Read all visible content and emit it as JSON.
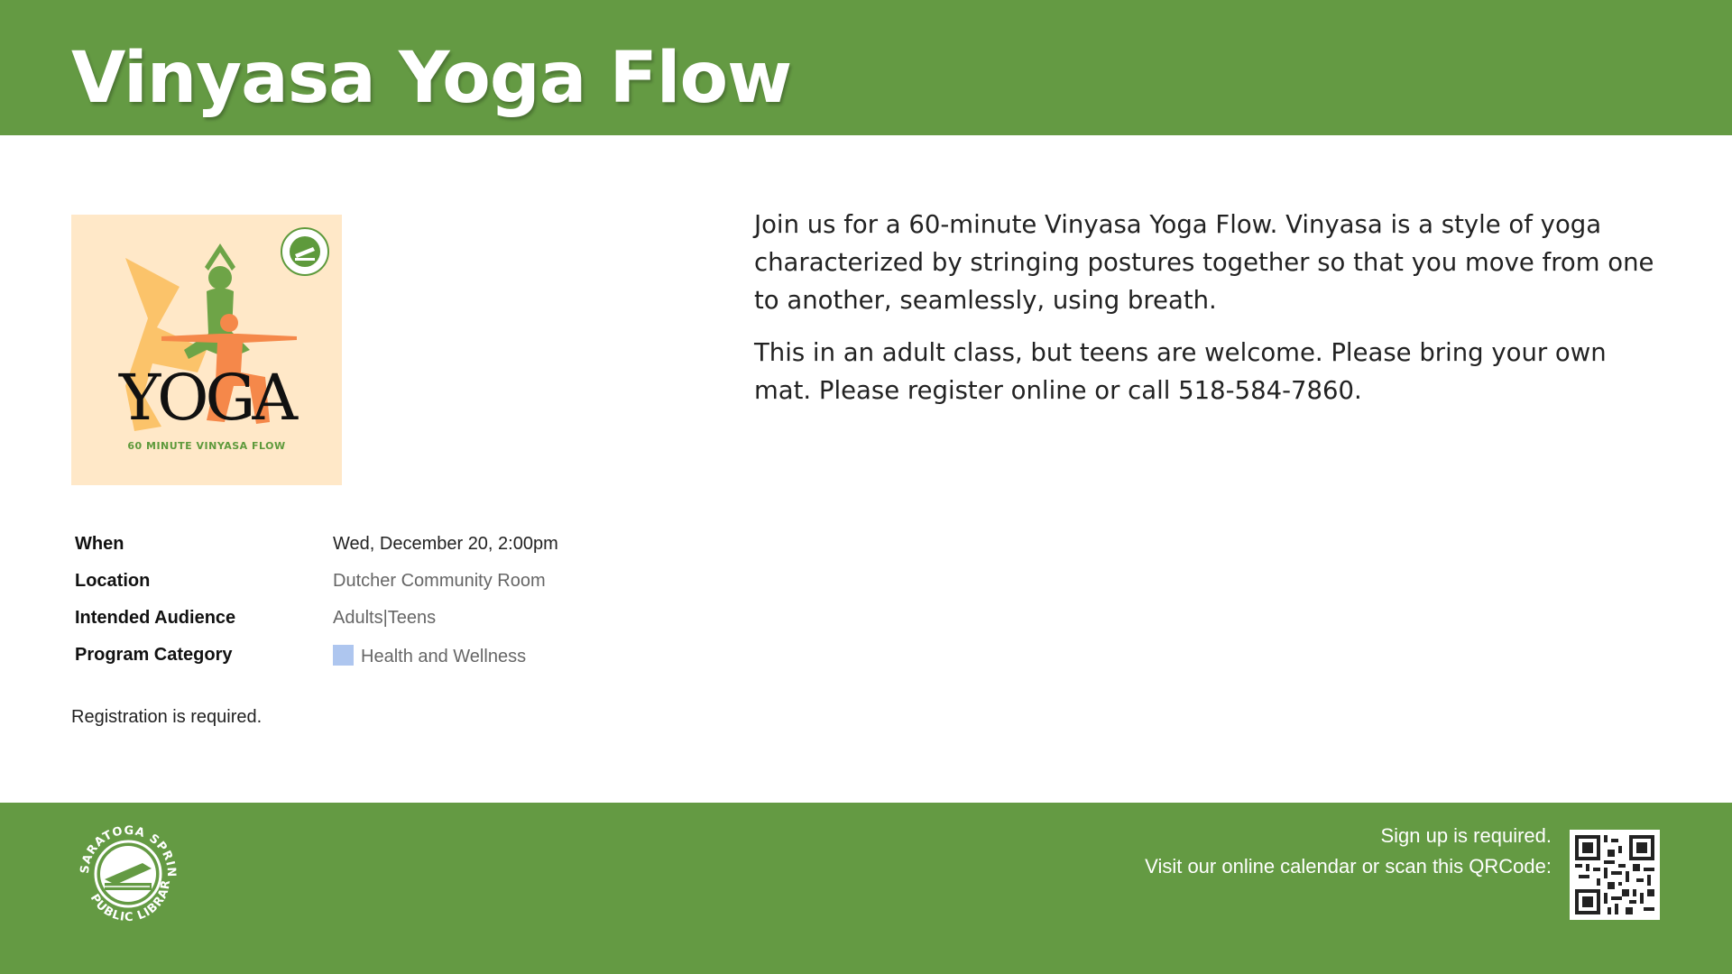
{
  "header": {
    "title": "Vinyasa Yoga Flow"
  },
  "poster": {
    "word": "YOGA",
    "subtitle": "60 MINUTE VINYASA FLOW",
    "badge": "SARATOGA SPRINGS PUBLIC LIBRARY"
  },
  "details": {
    "rows": [
      {
        "label": "When",
        "value": "Wed, December 20, 2:00pm"
      },
      {
        "label": "Location",
        "value": "Dutcher Community Room"
      },
      {
        "label": "Intended Audience",
        "value": "Adults|Teens"
      },
      {
        "label": "Program Category",
        "value": "Health and Wellness"
      }
    ],
    "category_color": "#aec6ef"
  },
  "registration_note": "Registration is required.",
  "description": {
    "paragraphs": [
      "Join us for a 60-minute Vinyasa Yoga Flow. Vinyasa is a style of yoga characterized by stringing postures together so that you move from one to another, seamlessly, using breath.",
      "This in an adult class, but teens are welcome. Please bring your own mat. Please register online or call 518-584-7860."
    ]
  },
  "footer": {
    "logo_text_top": "SARATOGA SPRINGS",
    "logo_text_bottom": "PUBLIC LIBRARY",
    "line1": "Sign up is required.",
    "line2": "Visit our online calendar or scan this QRCode:",
    "qr_icon": "qr-code-icon"
  },
  "colors": {
    "brand_green": "#649a43",
    "poster_bg": "#ffe8c8"
  }
}
